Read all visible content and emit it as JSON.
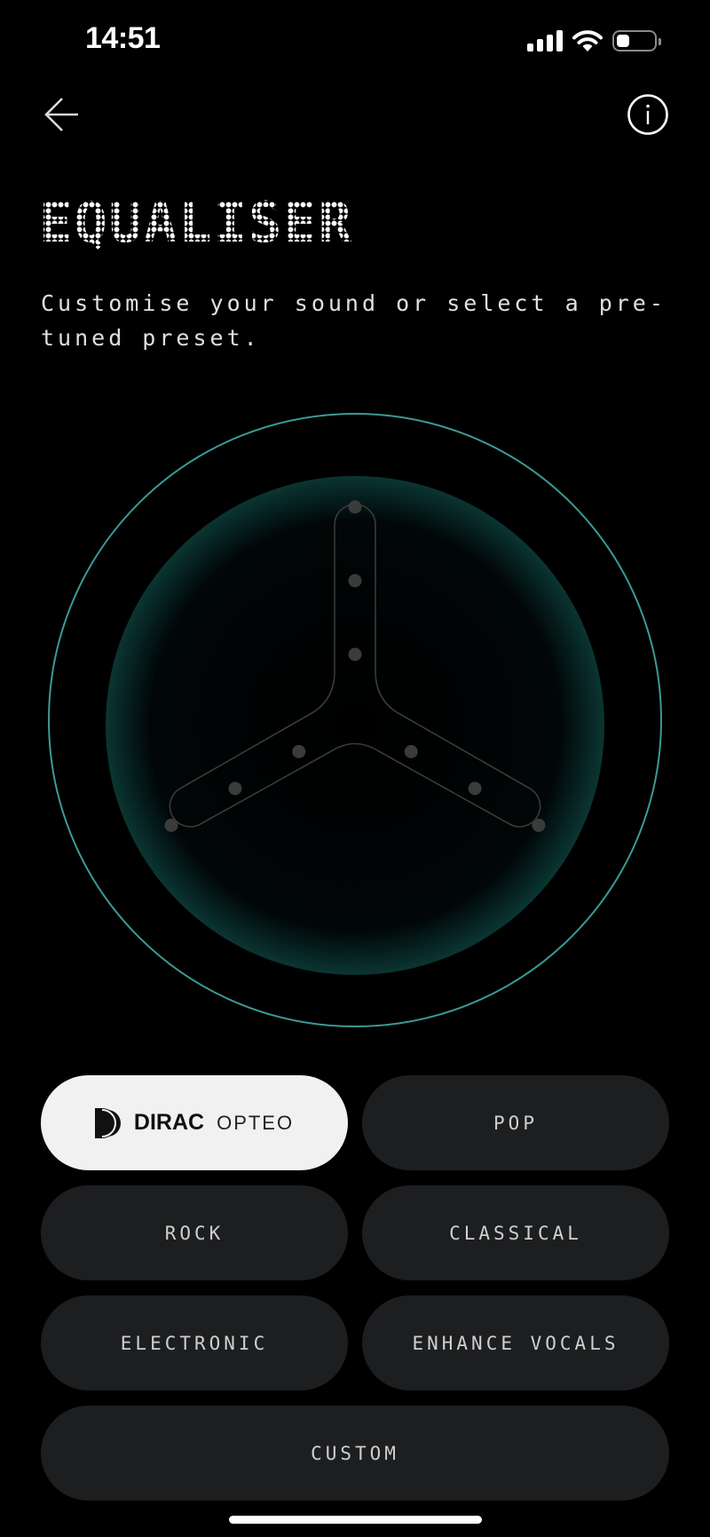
{
  "status_bar": {
    "time": "14:51",
    "signal_bars": 4,
    "wifi": "wifi-icon",
    "battery_percent": 35
  },
  "nav": {
    "back_icon": "arrow-left-icon",
    "info_icon": "info-icon"
  },
  "header": {
    "title": "EQUALISER",
    "subtitle": "Customise your sound or select a pre-tuned preset."
  },
  "equaliser": {
    "accent_color": "#3a9a98",
    "bands": [
      {
        "name": "top",
        "markers": [
          1,
          2,
          3
        ]
      },
      {
        "name": "left",
        "markers": [
          1,
          2,
          3
        ]
      },
      {
        "name": "right",
        "markers": [
          1,
          2,
          3
        ]
      }
    ]
  },
  "presets": {
    "selected": "dirac_opteo",
    "items": [
      {
        "id": "dirac_opteo",
        "brand": "DIRAC",
        "label": "OPTEO",
        "active": true
      },
      {
        "id": "pop",
        "label": "POP",
        "active": false
      },
      {
        "id": "rock",
        "label": "ROCK",
        "active": false
      },
      {
        "id": "classical",
        "label": "CLASSICAL",
        "active": false
      },
      {
        "id": "electronic",
        "label": "ELECTRONIC",
        "active": false
      },
      {
        "id": "enhance_vocals",
        "label": "ENHANCE VOCALS",
        "active": false
      },
      {
        "id": "custom",
        "label": "CUSTOM",
        "active": false
      }
    ]
  }
}
